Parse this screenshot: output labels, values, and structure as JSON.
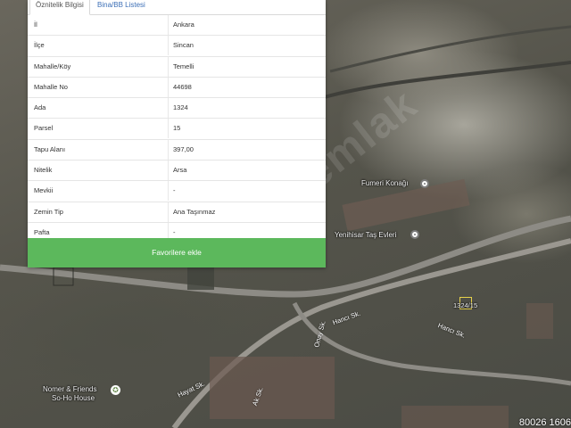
{
  "tabs": [
    {
      "label": "Öznitelik Bilgisi"
    },
    {
      "label": "Bina/BB Listesi"
    }
  ],
  "attributes": [
    {
      "key": "İl",
      "value": "Ankara"
    },
    {
      "key": "İlçe",
      "value": "Sincan"
    },
    {
      "key": "Mahalle/Köy",
      "value": "Temelli"
    },
    {
      "key": "Mahalle No",
      "value": "44698"
    },
    {
      "key": "Ada",
      "value": "1324"
    },
    {
      "key": "Parsel",
      "value": "15"
    },
    {
      "key": "Tapu Alanı",
      "value": "397,00"
    },
    {
      "key": "Nitelik",
      "value": "Arsa"
    },
    {
      "key": "Mevkii",
      "value": "-"
    },
    {
      "key": "Zemin Tip",
      "value": "Ana Taşınmaz"
    },
    {
      "key": "Pafta",
      "value": "-"
    }
  ],
  "favorite_button": "Favorilere ekle",
  "map": {
    "places": [
      {
        "name": "Fumeri Konağı",
        "icon": "location-pin-icon"
      },
      {
        "name": "Yenihisar Taş Evleri",
        "icon": "location-pin-icon"
      },
      {
        "name_line1": "Nomer & Friends",
        "name_line2": "So-Ho House",
        "icon": "star-pin-icon"
      }
    ],
    "parcel_label": "1324/15",
    "streets": [
      "Hancı Sk.",
      "Hancı Sk.",
      "Onay Sk.",
      "Hayat Sk.",
      "Ak Sk."
    ],
    "watermark": "hepsiemlak",
    "coordinate": "80026 1606"
  }
}
